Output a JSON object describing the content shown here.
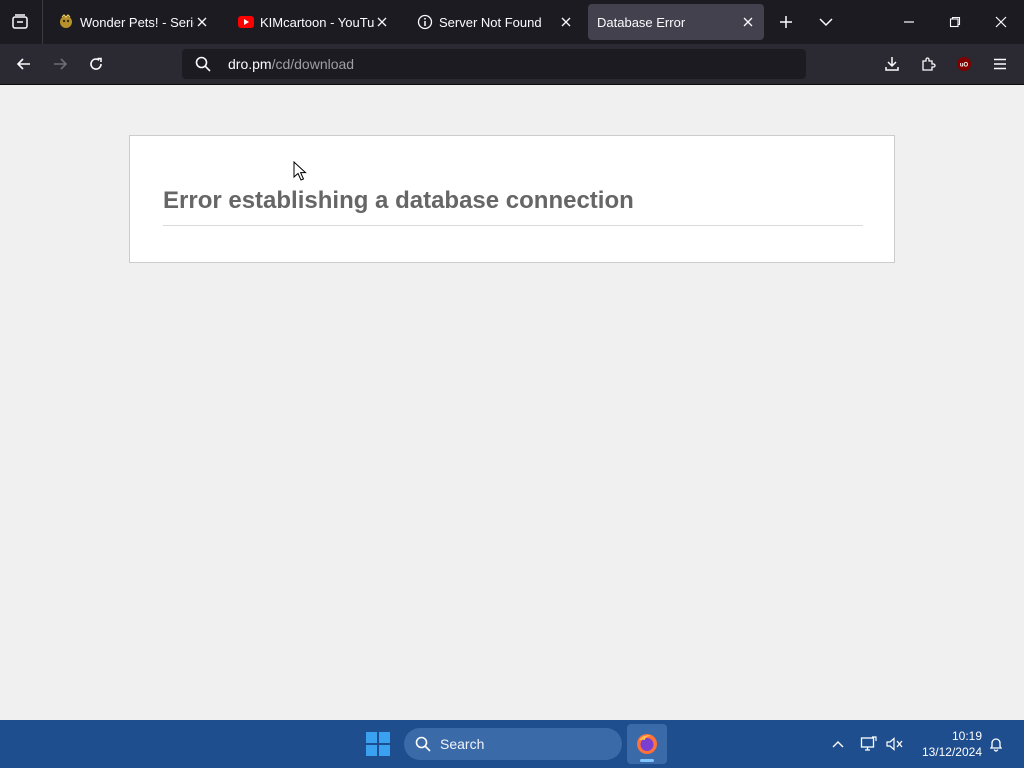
{
  "browser": {
    "tabs": [
      {
        "title": "Wonder Pets! - Series (",
        "active": false,
        "favicon": "wonder-pets-favicon"
      },
      {
        "title": "KIMcartoon - YouTube",
        "active": false,
        "favicon": "youtube-favicon"
      },
      {
        "title": "Server Not Found",
        "active": false,
        "favicon": "info-icon"
      },
      {
        "title": "Database Error",
        "active": true,
        "favicon": "none"
      }
    ],
    "url": {
      "host": "dro.pm",
      "path": "/cd/download"
    }
  },
  "page": {
    "heading": "Error establishing a database connection"
  },
  "taskbar": {
    "search_label": "Search",
    "time": "10:19",
    "date": "13/12/2024"
  },
  "colors": {
    "tabstrip_bg": "#1c1b22",
    "toolbar_bg": "#2b2a33",
    "active_tab_bg": "#42414d",
    "taskbar_bg": "#1f4e8f",
    "heading_color": "#666666"
  }
}
